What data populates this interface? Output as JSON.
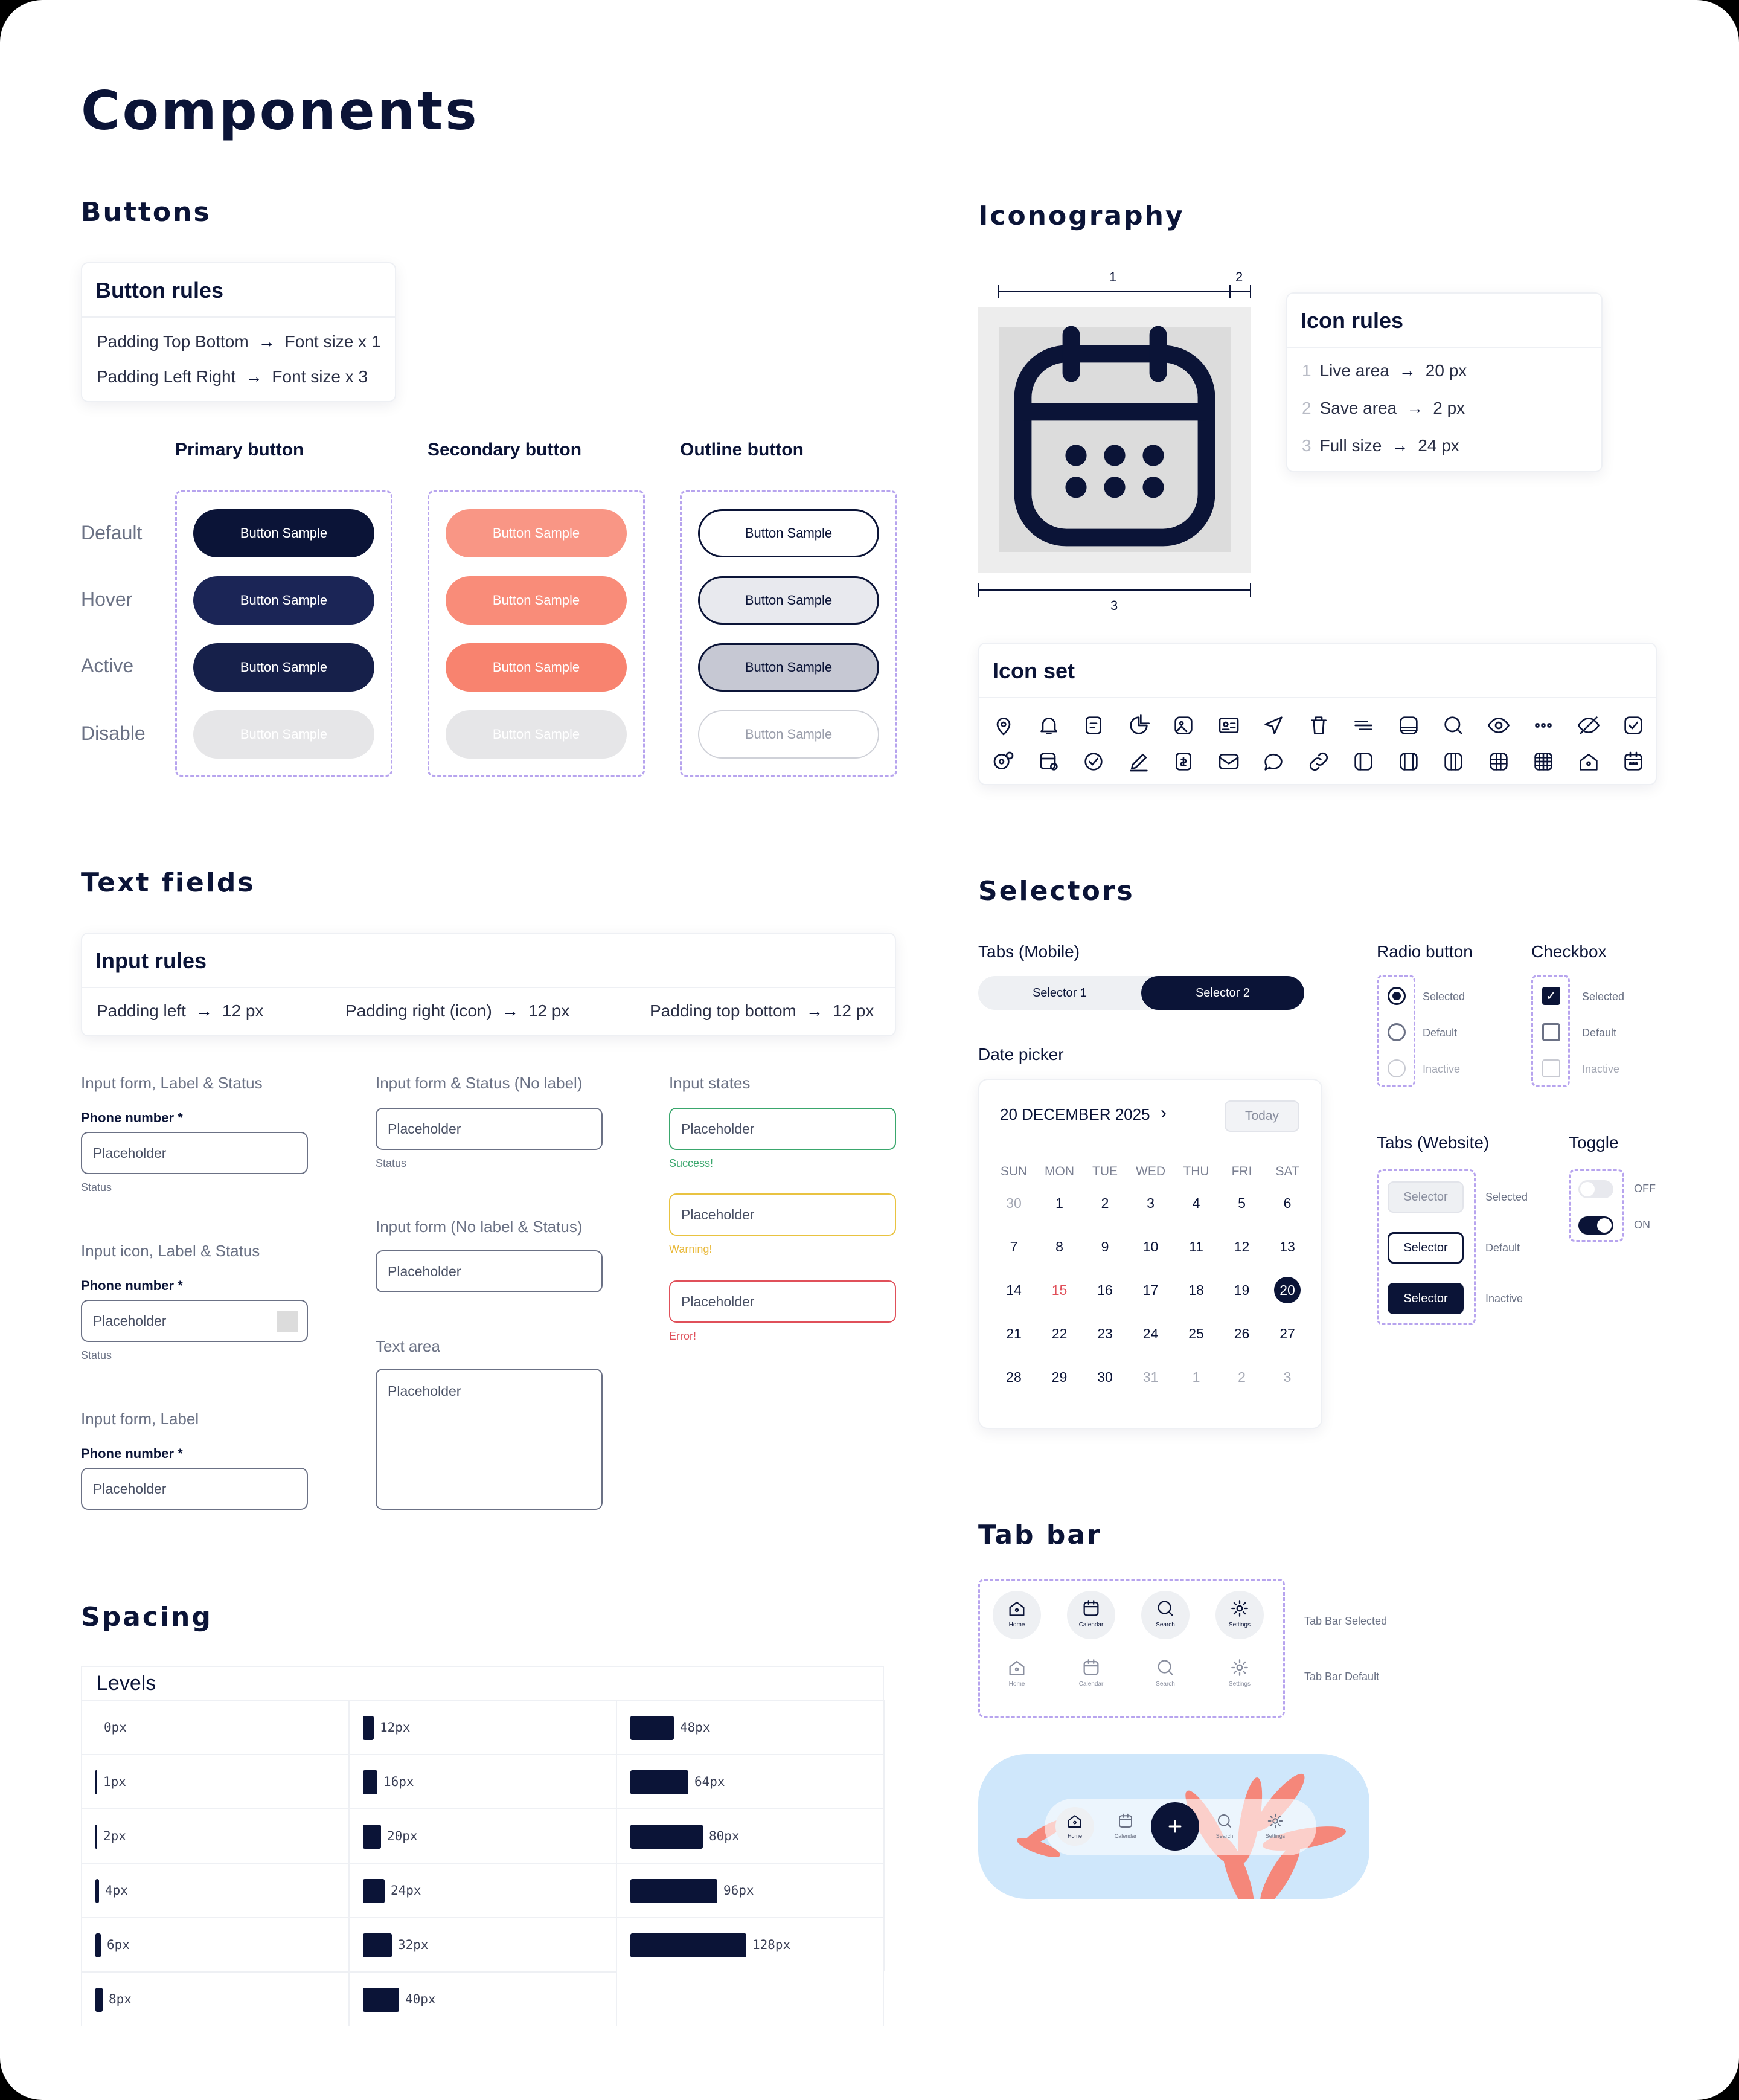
{
  "page_title": "Components",
  "buttons": {
    "section_title": "Buttons",
    "rules_title": "Button rules",
    "rules": [
      {
        "left": "Padding Top Bottom",
        "right": "Font size x 1"
      },
      {
        "left": "Padding Left Right",
        "right": "Font size x 3"
      }
    ],
    "columns": [
      "Primary button",
      "Secondary button",
      "Outline button"
    ],
    "states": [
      "Default",
      "Hover",
      "Active",
      "Disable"
    ],
    "sample_label": "Button Sample",
    "colors": {
      "primary": "#0b1437",
      "secondary": "#f99685",
      "disabled": "#e6e6e8"
    }
  },
  "iconography": {
    "section_title": "Iconography",
    "dim_labels": [
      "1",
      "2",
      "3"
    ],
    "rules_title": "Icon rules",
    "rules": [
      {
        "num": "1",
        "left": "Live area",
        "right": "20 px"
      },
      {
        "num": "2",
        "left": "Save area",
        "right": "2 px"
      },
      {
        "num": "3",
        "left": "Full size",
        "right": "24 px"
      }
    ],
    "iconset_title": "Icon set",
    "icons_row1": [
      "location-pin-icon",
      "bell-icon",
      "calendar-note-icon",
      "pie-chart-icon",
      "image-icon",
      "id-card-icon",
      "send-icon",
      "trash-icon",
      "menu-lines-icon",
      "storage-icon",
      "search-icon",
      "eye-icon",
      "more-icon",
      "eye-off-icon",
      "checkbox-icon"
    ],
    "icons_row2": [
      "location-settings-icon",
      "calendar-settings-icon",
      "check-circle-icon",
      "edit-icon",
      "dollar-box-icon",
      "mail-icon",
      "chat-icon",
      "link-icon",
      "panel-left-icon",
      "panel-both-icon",
      "columns-icon",
      "grid-icon",
      "grid-fine-icon",
      "home-icon",
      "calendar-icon"
    ]
  },
  "text_fields": {
    "section_title": "Text fields",
    "rules_title": "Input rules",
    "rules": [
      {
        "left": "Padding left",
        "right": "12 px"
      },
      {
        "left": "Padding right (icon)",
        "right": "12 px"
      },
      {
        "left": "Padding top bottom",
        "right": "12 px"
      }
    ],
    "placeholder": "Placeholder",
    "col1": [
      {
        "title": "Input form, Label & Status",
        "label": "Phone number *",
        "status": "Status"
      },
      {
        "title": "Input icon, Label & Status",
        "label": "Phone number *",
        "status": "Status"
      },
      {
        "title": "Input form, Label",
        "label": "Phone number *"
      }
    ],
    "col2": {
      "no_label_title": "Input form & Status (No label)",
      "no_label_status": "Status",
      "no_label_no_status_title": "Input form (No label & Status)",
      "text_area_title": "Text area"
    },
    "col3": {
      "title": "Input states",
      "success": "Success!",
      "warning": "Warning!",
      "error": "Error!",
      "colors": {
        "success": "#3aa76d",
        "warning": "#e9c341",
        "error": "#e0505a"
      }
    }
  },
  "selectors": {
    "section_title": "Selectors",
    "tabs_mobile_title": "Tabs (Mobile)",
    "tabs_mobile": [
      "Selector 1",
      "Selector 2"
    ],
    "radio_title": "Radio button",
    "checkbox_title": "Checkbox",
    "states": [
      "Selected",
      "Default",
      "Inactive"
    ],
    "date_picker_title": "Date picker",
    "date_picker": {
      "month": "20 DECEMBER 2025",
      "today": "Today",
      "weekdays": [
        "SUN",
        "MON",
        "TUE",
        "WED",
        "THU",
        "FRI",
        "SAT"
      ],
      "weeks": [
        [
          "30",
          "1",
          "2",
          "3",
          "4",
          "5",
          "6"
        ],
        [
          "7",
          "8",
          "9",
          "10",
          "11",
          "12",
          "13"
        ],
        [
          "14",
          "15",
          "16",
          "17",
          "18",
          "19",
          "20"
        ],
        [
          "21",
          "22",
          "23",
          "24",
          "25",
          "26",
          "27"
        ],
        [
          "28",
          "29",
          "30",
          "31",
          "1",
          "2",
          "3"
        ]
      ]
    },
    "tabs_website_title": "Tabs (Website)",
    "tabs_website_label": "Selector",
    "toggle_title": "Toggle",
    "toggle_states": [
      "OFF",
      "ON"
    ]
  },
  "tab_bar": {
    "section_title": "Tab bar",
    "items": [
      "Home",
      "Calendar",
      "Search",
      "Settings"
    ],
    "selected_label": "Tab Bar Selected",
    "default_label": "Tab Bar Default"
  },
  "spacing": {
    "section_title": "Spacing",
    "levels_title": "Levels",
    "columns": [
      [
        {
          "label": "0px",
          "value": 0
        },
        {
          "label": "1px",
          "value": 1
        },
        {
          "label": "2px",
          "value": 2
        },
        {
          "label": "4px",
          "value": 4
        },
        {
          "label": "6px",
          "value": 6
        },
        {
          "label": "8px",
          "value": 8
        }
      ],
      [
        {
          "label": "12px",
          "value": 12
        },
        {
          "label": "16px",
          "value": 16
        },
        {
          "label": "20px",
          "value": 20
        },
        {
          "label": "24px",
          "value": 24
        },
        {
          "label": "32px",
          "value": 32
        },
        {
          "label": "40px",
          "value": 40
        }
      ],
      [
        {
          "label": "48px",
          "value": 48
        },
        {
          "label": "64px",
          "value": 64
        },
        {
          "label": "80px",
          "value": 80
        },
        {
          "label": "96px",
          "value": 96
        },
        {
          "label": "128px",
          "value": 128
        }
      ]
    ]
  }
}
